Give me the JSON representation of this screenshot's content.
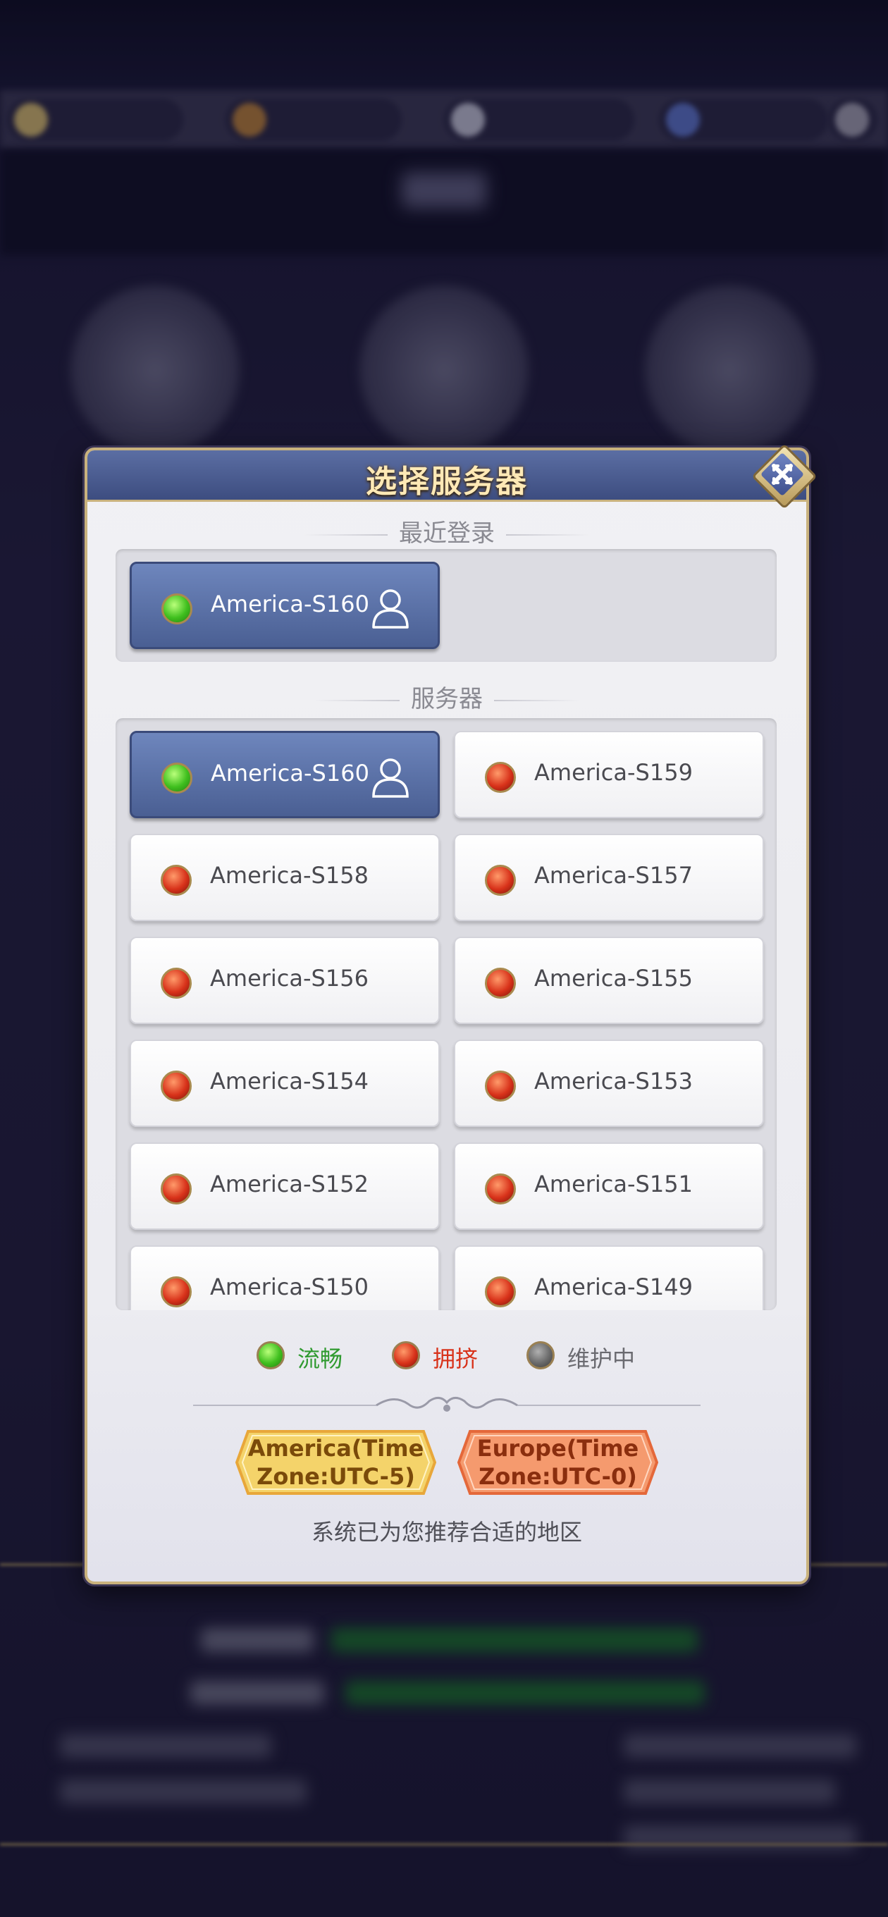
{
  "dialog": {
    "title": "选择服务器",
    "recent_label": "最近登录",
    "servers_label": "服务器",
    "recent_server": {
      "name": "America-S160",
      "status": "green",
      "status_color": "#3fbf1e",
      "icon": "user-icon"
    },
    "servers": [
      {
        "name": "America-S160",
        "status": "green",
        "selected": true,
        "icon": "user-icon"
      },
      {
        "name": "America-S159",
        "status": "red"
      },
      {
        "name": "America-S158",
        "status": "red"
      },
      {
        "name": "America-S157",
        "status": "red"
      },
      {
        "name": "America-S156",
        "status": "red"
      },
      {
        "name": "America-S155",
        "status": "red"
      },
      {
        "name": "America-S154",
        "status": "red"
      },
      {
        "name": "America-S153",
        "status": "red"
      },
      {
        "name": "America-S152",
        "status": "red"
      },
      {
        "name": "America-S151",
        "status": "red"
      },
      {
        "name": "America-S150",
        "status": "red"
      },
      {
        "name": "America-S149",
        "status": "red"
      }
    ],
    "legend": [
      {
        "status": "green",
        "label": "流畅",
        "color": "#2f9a2f"
      },
      {
        "status": "red",
        "label": "拥挤",
        "color": "#d8321a"
      },
      {
        "status": "gray",
        "label": "维护中",
        "color": "#6a6a70"
      }
    ],
    "regions": [
      {
        "label_line1": "America(Time",
        "label_line2": "Zone:UTC-5)",
        "color": "#f4d36a",
        "text_color": "#7a4a0a"
      },
      {
        "label_line1": "Europe(Time",
        "label_line2": "Zone:UTC-0)",
        "color": "#f59a6e",
        "text_color": "#8a2e0e"
      }
    ],
    "hint": "系统已为您推荐合适的地区"
  }
}
